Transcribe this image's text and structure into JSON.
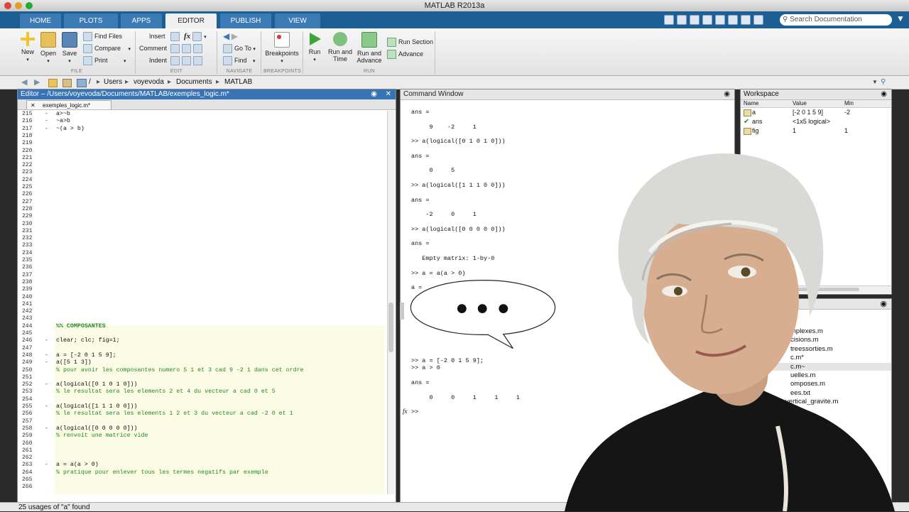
{
  "window": {
    "title": "MATLAB R2013a"
  },
  "ribbon_tabs": [
    "HOME",
    "PLOTS",
    "APPS",
    "EDITOR",
    "PUBLISH",
    "VIEW"
  ],
  "active_tab": "EDITOR",
  "search": {
    "placeholder": "Search Documentation"
  },
  "ribbon": {
    "file": {
      "new": "New",
      "open": "Open",
      "save": "Save",
      "find_files": "Find Files",
      "compare": "Compare",
      "print": "Print",
      "group": "FILE"
    },
    "edit": {
      "insert": "Insert",
      "comment": "Comment",
      "indent": "Indent",
      "fx": "fx",
      "group": "EDIT"
    },
    "navigate": {
      "go_to": "Go To",
      "find": "Find",
      "group": "NAVIGATE"
    },
    "breakpoints": {
      "label": "Breakpoints",
      "group": "BREAKPOINTS"
    },
    "run": {
      "run": "Run",
      "run_and_time": "Run and Time",
      "run_and_advance": "Run and Advance",
      "run_section": "Run Section",
      "advance": "Advance",
      "group": "RUN"
    }
  },
  "path": [
    "/",
    "Users",
    "voyevoda",
    "Documents",
    "MATLAB"
  ],
  "editor": {
    "title": "Editor – /Users/voyevoda/Documents/MATLAB/exemples_logic.m*",
    "tab": "exemples_logic.m*",
    "top_code": [
      "a>~b",
      "~a>b",
      "~(a > b)"
    ],
    "code_lines": [
      {
        "n": "244",
        "text": "%% COMPOSANTES",
        "cls": "cellh",
        "dash": false
      },
      {
        "n": "245",
        "text": "",
        "cls": "",
        "dash": false
      },
      {
        "n": "246",
        "text": "clear; clc; fig=1;",
        "cls": "",
        "dash": true
      },
      {
        "n": "247",
        "text": "",
        "cls": "",
        "dash": false
      },
      {
        "n": "248",
        "text": "a = [-2 0 1 5 9];",
        "cls": "",
        "dash": true
      },
      {
        "n": "249",
        "text": "a([5 1 3])",
        "cls": "",
        "dash": true
      },
      {
        "n": "250",
        "text": "% pour avoir les composantes numero 5 1 et 3 cad 9 -2 1 dans cet ordre",
        "cls": "cm",
        "dash": false
      },
      {
        "n": "251",
        "text": "",
        "cls": "",
        "dash": false
      },
      {
        "n": "252",
        "text": "a(logical([0 1 0 1 0]))",
        "cls": "",
        "dash": true
      },
      {
        "n": "253",
        "text": "% le resultat sera les elements 2 et 4 du vecteur a cad 0 et 5",
        "cls": "cm",
        "dash": false
      },
      {
        "n": "254",
        "text": "",
        "cls": "",
        "dash": false
      },
      {
        "n": "255",
        "text": "a(logical([1 1 1 0 0]))",
        "cls": "",
        "dash": true
      },
      {
        "n": "256",
        "text": "% le resultat sera les elements 1 2 et 3 du vecteur a cad -2 0 et 1",
        "cls": "cm",
        "dash": false
      },
      {
        "n": "257",
        "text": "",
        "cls": "",
        "dash": false
      },
      {
        "n": "258",
        "text": "a(logical([0 0 0 0 0]))",
        "cls": "",
        "dash": true
      },
      {
        "n": "259",
        "text": "% renvoit une matrice vide",
        "cls": "cm",
        "dash": false
      },
      {
        "n": "260",
        "text": "",
        "cls": "",
        "dash": false
      },
      {
        "n": "261",
        "text": "",
        "cls": "",
        "dash": false
      },
      {
        "n": "262",
        "text": "",
        "cls": "",
        "dash": false
      },
      {
        "n": "263",
        "text": "a = a(a > 0)",
        "cls": "",
        "dash": true
      },
      {
        "n": "264",
        "text": "% pratique pour enlever tous les termes negatifs par exemple",
        "cls": "cm",
        "dash": false
      },
      {
        "n": "265",
        "text": "",
        "cls": "",
        "dash": false
      },
      {
        "n": "266",
        "text": "",
        "cls": "",
        "dash": false
      }
    ]
  },
  "command_window": {
    "title": "Command Window",
    "lines": [
      "ans =",
      "",
      "     9    -2     1",
      "",
      ">> a(logical([0 1 0 1 0]))",
      "",
      "ans =",
      "",
      "     0     5",
      "",
      ">> a(logical([1 1 1 0 0]))",
      "",
      "ans =",
      "",
      "    -2     0     1",
      "",
      ">> a(logical([0 0 0 0 0]))",
      "",
      "ans =",
      "",
      "   Empty matrix: 1-by-0",
      "",
      ">> a = a(a > 0)",
      "",
      "a ="
    ],
    "lower_lines": [
      ">> a = [-2 0 1 5 9];",
      ">> a > 0",
      "",
      "ans =",
      "",
      "     0     0     1     1     1",
      "",
      ">>"
    ],
    "fx": "fx"
  },
  "workspace": {
    "title": "Workspace",
    "columns": [
      "Name",
      "Value",
      "Min"
    ],
    "rows": [
      {
        "name": "a",
        "value": "[-2 0 1 5 9]",
        "min": "-2"
      },
      {
        "name": "ans",
        "value": "<1x5 logical>",
        "min": ""
      },
      {
        "name": "fig",
        "value": "1",
        "min": "1"
      }
    ]
  },
  "files": [
    "mplexes.m",
    "cisions.m",
    "treessorties.m",
    "c.m*",
    "c.m~",
    "uelles.m",
    "omposes.m",
    "ees.txt",
    "t_vertical_gravite.m"
  ],
  "status": "25 usages of \"a\" found",
  "colors": {
    "tab_bar": "#1c5f95",
    "editor_title": "#3774b5",
    "comment": "#228b22",
    "cell_bg": "#fbfbe6"
  }
}
